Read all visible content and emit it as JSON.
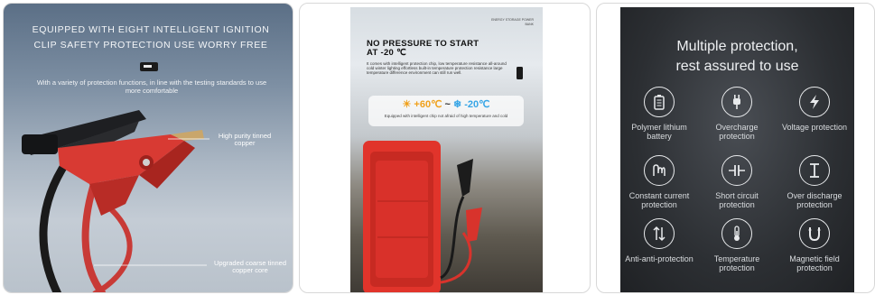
{
  "card1": {
    "title": "EQUIPPED WITH EIGHT INTELLIGENT IGNITION CLIP SAFETY PROTECTION USE WORRY FREE",
    "subtitle": "With a variety of protection functions, in line with the testing standards to use more comfortable",
    "label_copper": "High purity tinned copper",
    "label_core": "Upgraded coarse tinned copper core",
    "colors": {
      "clip_red": "#d83a33",
      "clip_black": "#1e1f22"
    }
  },
  "card2": {
    "title_line1": "NO PRESSURE TO START",
    "title_line2": "AT -20 ℃",
    "body": "It comes with intelligent protection chip, low temperature resistance all-around cold winter lighting effortless built-in temperature protection resistance large temperature difference environment can still run well.",
    "top_right": "ENERGY STORAGE POWER BANK",
    "temp_hot": "+60℃",
    "temp_sep": "~",
    "temp_cold": "-20℃",
    "note": "Equipped with intelligent chip not afraid of high temperature and cold",
    "colors": {
      "device_red": "#e1342b",
      "hot": "#f0a11c",
      "cold": "#37a5e6"
    }
  },
  "card3": {
    "heading_line1": "Multiple protection,",
    "heading_line2": "rest assured to use",
    "items": [
      {
        "icon": "battery-icon",
        "label": "Polymer lithium battery"
      },
      {
        "icon": "plug-icon",
        "label": "Overcharge protection"
      },
      {
        "icon": "lightning-icon",
        "label": "Voltage protection"
      },
      {
        "icon": "coil-icon",
        "label": "Constant current protection"
      },
      {
        "icon": "short-circuit-icon",
        "label": "Short circuit protection"
      },
      {
        "icon": "discharge-icon",
        "label": "Over discharge protection"
      },
      {
        "icon": "arrows-icon",
        "label": "Anti-anti-protection"
      },
      {
        "icon": "thermometer-icon",
        "label": "Temperature protection"
      },
      {
        "icon": "magnet-icon",
        "label": "Magnetic field protection"
      }
    ]
  }
}
